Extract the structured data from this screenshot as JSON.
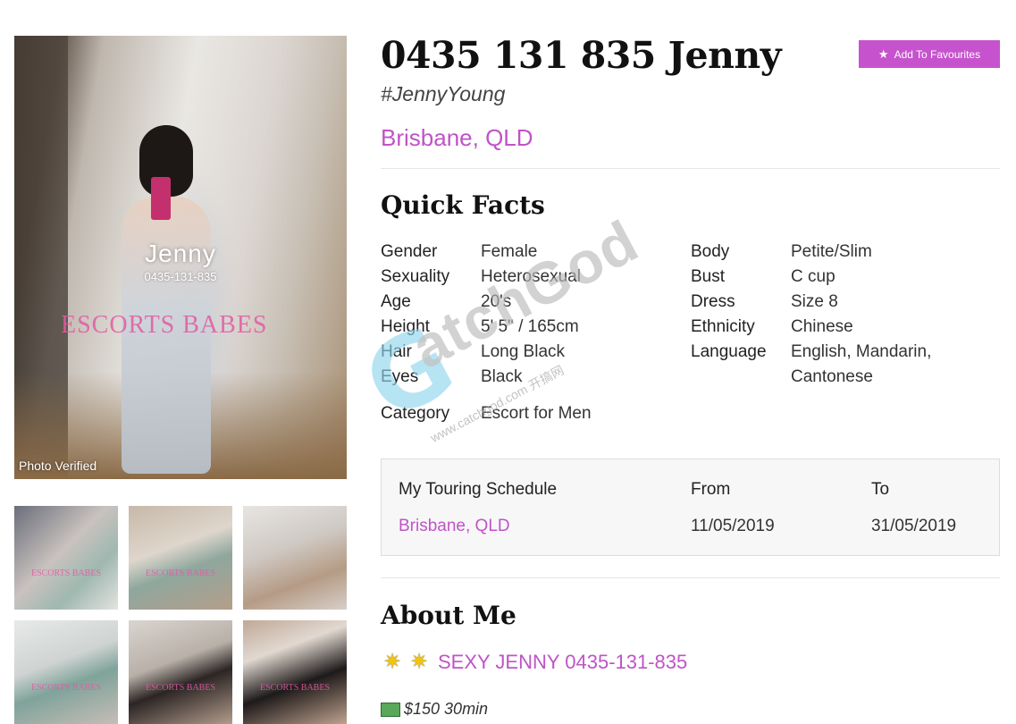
{
  "profile": {
    "title": "0435 131 835 Jenny",
    "hashtag": "#JennyYoung",
    "location": "Brisbane, QLD",
    "favourite_label": "Add To Favourites"
  },
  "photo": {
    "watermark_name": "Jenny",
    "watermark_phone": "0435-131-835",
    "watermark_brand": "ESCORTS BABES",
    "verified_label": "Photo Verified",
    "thumbnail_watermarks": [
      "ESCORTS BABES",
      "ESCORTS BABES",
      "",
      "ESCORTS BABES",
      "ESCORTS BABES",
      "ESCORTS BABES"
    ]
  },
  "quick_facts": {
    "title": "Quick Facts",
    "left": [
      {
        "label": "Gender",
        "value": "Female"
      },
      {
        "label": "Sexuality",
        "value": "Heterosexual"
      },
      {
        "label": "Age",
        "value": "20's"
      },
      {
        "label": "Height",
        "value": "5' 5\" / 165cm"
      },
      {
        "label": "Hair",
        "value": "Long Black"
      },
      {
        "label": "Eyes",
        "value": "Black"
      }
    ],
    "category": {
      "label": "Category",
      "value": "Escort for Men"
    },
    "right": [
      {
        "label": "Body",
        "value": "Petite/Slim"
      },
      {
        "label": "Bust",
        "value": "C cup"
      },
      {
        "label": "Dress",
        "value": "Size 8"
      },
      {
        "label": "Ethnicity",
        "value": "Chinese"
      },
      {
        "label": "Language",
        "value": "English, Mandarin, Cantonese"
      }
    ]
  },
  "touring": {
    "header_schedule": "My Touring Schedule",
    "header_from": "From",
    "header_to": "To",
    "rows": [
      {
        "location": "Brisbane, QLD",
        "from": "11/05/2019",
        "to": "31/05/2019"
      }
    ]
  },
  "about": {
    "title": "About Me",
    "headline": "SEXY JENNY 0435-131-835",
    "price_line": "$150 30min"
  },
  "watermark": {
    "brand": "atchGod",
    "url": "www.catchgod.com 开搞网"
  },
  "colors": {
    "accent": "#c053c7",
    "button": "#c653cd"
  },
  "icons": {
    "favourite": "star-icon",
    "headline": "sparkle-star-icon",
    "price": "money-icon"
  }
}
